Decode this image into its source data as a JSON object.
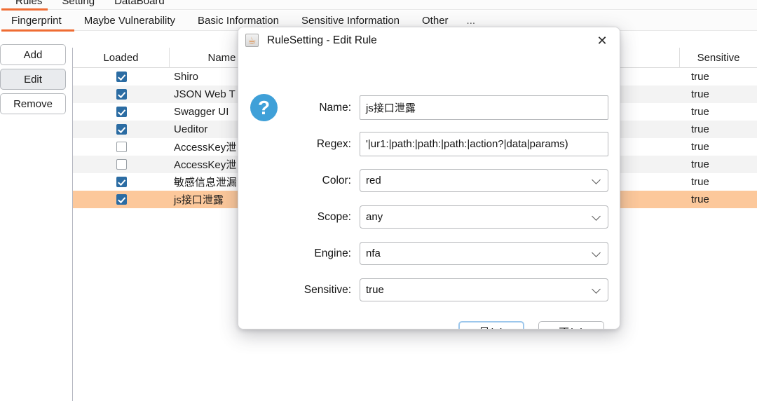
{
  "top_tabs_clipped": {
    "items": [
      "Rules",
      "Setting",
      "DataBoard"
    ]
  },
  "tabbar": {
    "items": [
      {
        "label": "Fingerprint",
        "selected": true
      },
      {
        "label": "Maybe Vulnerability",
        "selected": false
      },
      {
        "label": "Basic Information",
        "selected": false
      },
      {
        "label": "Sensitive Information",
        "selected": false
      },
      {
        "label": "Other",
        "selected": false
      },
      {
        "label": "...",
        "selected": false
      }
    ],
    "accent_color": "#ef6c33"
  },
  "side_buttons": [
    {
      "label": "Add",
      "selected": false
    },
    {
      "label": "Edit",
      "selected": true
    },
    {
      "label": "Remove",
      "selected": false
    }
  ],
  "table": {
    "columns": [
      "Loaded",
      "Name",
      "",
      "Sensitive"
    ],
    "selected_row_color": "#fcc89b",
    "rows": [
      {
        "loaded": true,
        "name": "Shiro",
        "mid": "",
        "sensitive": "true",
        "selected": false
      },
      {
        "loaded": true,
        "name": "JSON Web T",
        "mid": "",
        "sensitive": "true",
        "selected": false
      },
      {
        "loaded": true,
        "name": "Swagger UI",
        "mid": "",
        "sensitive": "true",
        "selected": false
      },
      {
        "loaded": true,
        "name": "Ueditor",
        "mid": "",
        "sensitive": "true",
        "selected": false
      },
      {
        "loaded": false,
        "name": "AccessKey泄",
        "mid": "",
        "sensitive": "true",
        "selected": false
      },
      {
        "loaded": false,
        "name": "AccessKey泄",
        "mid": "",
        "sensitive": "true",
        "selected": false
      },
      {
        "loaded": true,
        "name": "敏感信息泄漏",
        "mid": "",
        "sensitive": "true",
        "selected": false
      },
      {
        "loaded": true,
        "name": "js接口泄露",
        "mid": "",
        "sensitive": "true",
        "selected": true
      }
    ]
  },
  "dialog": {
    "title": "RuleSetting - Edit Rule",
    "close_label": "✕",
    "icon": "java-coffee-icon",
    "help_icon_color": "#3fa0d8",
    "fields": [
      {
        "label": "Name:",
        "value": "js接口泄露",
        "type": "text"
      },
      {
        "label": "Regex:",
        "value": "'|ur1:|path:|path:|path:|action?|data|params)",
        "type": "text"
      },
      {
        "label": "Color:",
        "value": "red",
        "type": "select"
      },
      {
        "label": "Scope:",
        "value": "any",
        "type": "select"
      },
      {
        "label": "Engine:",
        "value": "nfa",
        "type": "select"
      },
      {
        "label": "Sensitive:",
        "value": "true",
        "type": "select"
      }
    ],
    "buttons": [
      {
        "label": "是(Y)",
        "accel": "Y",
        "primary": true
      },
      {
        "label": "否(N)",
        "accel": "N",
        "primary": false
      }
    ]
  }
}
